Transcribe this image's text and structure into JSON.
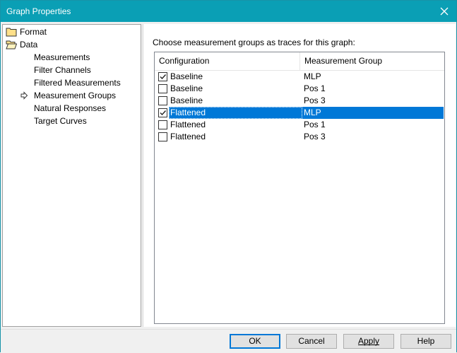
{
  "window": {
    "title": "Graph Properties"
  },
  "tree": {
    "items": [
      {
        "label": "Format",
        "icon": "folder-icon",
        "level": 0
      },
      {
        "label": "Data",
        "icon": "folder-open-icon",
        "level": 0
      },
      {
        "label": "Measurements",
        "level": 1
      },
      {
        "label": "Filter Channels",
        "level": 1
      },
      {
        "label": "Filtered Measurements",
        "level": 1
      },
      {
        "label": "Measurement Groups",
        "level": 1,
        "selected": true
      },
      {
        "label": "Natural Responses",
        "level": 1
      },
      {
        "label": "Target Curves",
        "level": 1
      }
    ]
  },
  "panel": {
    "instruction": "Choose measurement groups as traces for this graph:",
    "columns": [
      "Configuration",
      "Measurement Group"
    ],
    "rows": [
      {
        "configuration": "Baseline",
        "group": "MLP",
        "checked": true,
        "selected": false
      },
      {
        "configuration": "Baseline",
        "group": "Pos 1",
        "checked": false,
        "selected": false
      },
      {
        "configuration": "Baseline",
        "group": "Pos 3",
        "checked": false,
        "selected": false
      },
      {
        "configuration": "Flattened",
        "group": "MLP",
        "checked": true,
        "selected": true
      },
      {
        "configuration": "Flattened",
        "group": "Pos 1",
        "checked": false,
        "selected": false
      },
      {
        "configuration": "Flattened",
        "group": "Pos 3",
        "checked": false,
        "selected": false
      }
    ]
  },
  "footer": {
    "ok_label": "OK",
    "cancel_label": "Cancel",
    "apply_label": "Apply",
    "help_label": "Help"
  },
  "colors": {
    "titlebar": "#0a9fb5",
    "selection": "#0078d7"
  }
}
